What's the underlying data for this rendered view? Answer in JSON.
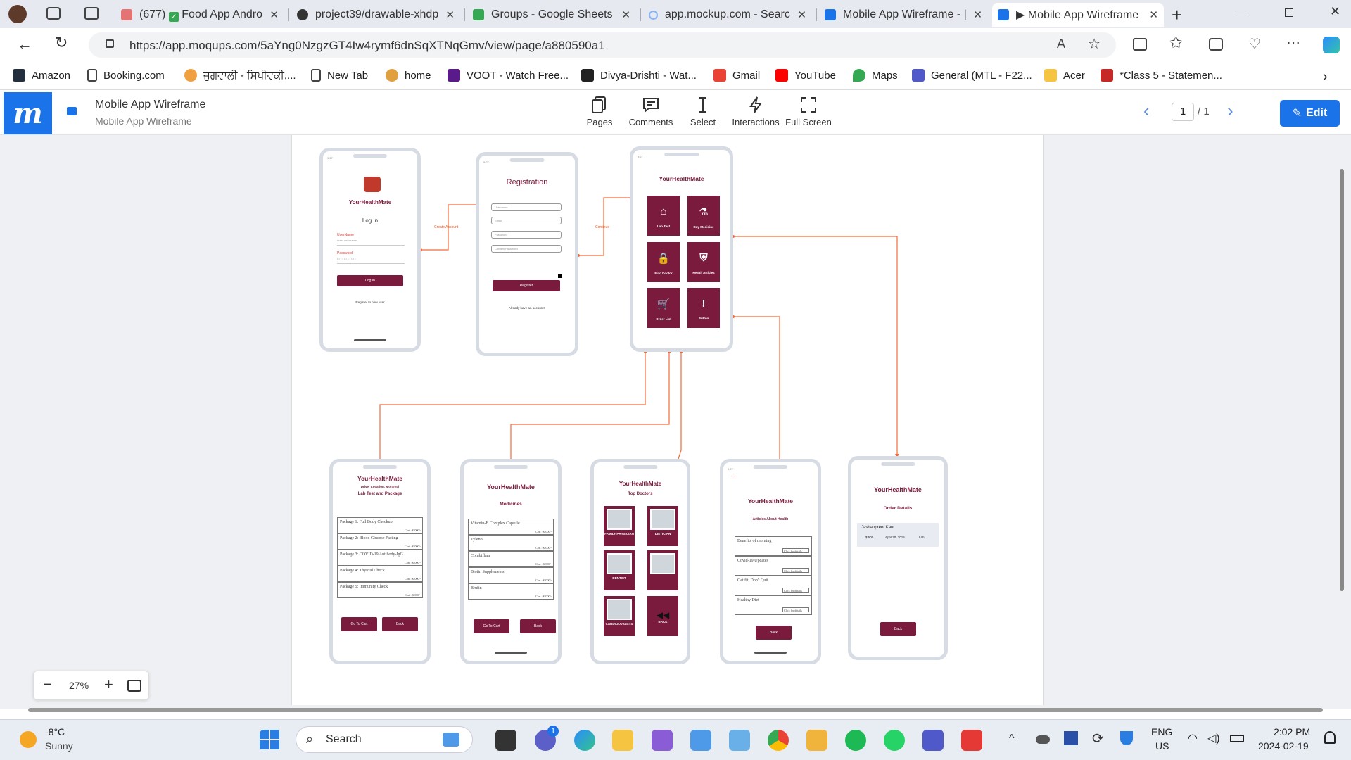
{
  "browser": {
    "tabs": [
      {
        "title": "(677)",
        "title2": "Food App Andro",
        "color": "#e57373"
      },
      {
        "title": "project39/drawable-xhdp",
        "color": "#333333"
      },
      {
        "title": "Groups - Google Sheets",
        "color": "#34a853"
      },
      {
        "title": "app.mockup.com - Searc",
        "color": "#8ab4f8"
      },
      {
        "title": "Mobile App Wireframe - |",
        "color": "#1a73e8"
      },
      {
        "title": "▶ Mobile App Wireframe",
        "color": "#1a73e8"
      }
    ],
    "url": "https://app.moqups.com/5aYng0NzgzGT4Iw4rymf6dnSqXTNqGmv/view/page/a880590a1",
    "bookmarks": [
      {
        "label": "Amazon",
        "color": "#232f3e"
      },
      {
        "label": "Booking.com",
        "color": "#ffffff"
      },
      {
        "label": "ਜੁਗਵਾਲੀ - ਸਿਖੀਵਕੀ,...",
        "color": "#f0a040"
      },
      {
        "label": "New Tab",
        "color": "#ffffff"
      },
      {
        "label": "home",
        "color": "#e0a040"
      },
      {
        "label": "VOOT - Watch Free...",
        "color": "#5a1a8a"
      },
      {
        "label": "Divya-Drishti - Wat...",
        "color": "#222222"
      },
      {
        "label": "Gmail",
        "color": "#ea4335"
      },
      {
        "label": "YouTube",
        "color": "#ff0000"
      },
      {
        "label": "Maps",
        "color": "#34a853"
      },
      {
        "label": "General (MTL - F22...",
        "color": "#5059c9"
      },
      {
        "label": "Acer",
        "color": "#f5c542"
      },
      {
        "label": "*Class 5 - Statemen...",
        "color": "#c62828"
      }
    ]
  },
  "moqups": {
    "title": "Mobile App Wireframe",
    "subtitle": "Mobile App Wireframe",
    "tools": [
      "Pages",
      "Comments",
      "Select",
      "Interactions",
      "Full Screen"
    ],
    "page_current": "1",
    "page_total": "/ 1",
    "edit_label": "Edit",
    "zoom": "27%"
  },
  "wireframe": {
    "app_name": "YourHealthMate",
    "login": {
      "heading": "Log In",
      "user_label": "UserName",
      "user_ph": "enter username",
      "pass_label": "Password",
      "pass_ph": "• • • • • • • • • • •",
      "button": "Log In",
      "link": "Register to new user"
    },
    "flow_labels": {
      "create": "Create Account",
      "continue": "Continue"
    },
    "registration": {
      "heading": "Registration",
      "fields": [
        "Username",
        "Email",
        "Password",
        "Confirm Password"
      ],
      "button": "Register",
      "link": "Already have an account?"
    },
    "home_tiles": [
      {
        "label": "Lab Test",
        "icon": "home-icon",
        "glyph": "⌂"
      },
      {
        "label": "Buy Medicine",
        "icon": "medicine-icon",
        "glyph": "⚗"
      },
      {
        "label": "Find Doctor",
        "icon": "lock-icon",
        "glyph": "🔒"
      },
      {
        "label": "Health Articles",
        "icon": "shield-icon",
        "glyph": "⛨"
      },
      {
        "label": "Order List",
        "icon": "cart-icon",
        "glyph": "🛒"
      },
      {
        "label": "Button",
        "icon": "exclamation-icon",
        "glyph": "!"
      }
    ],
    "lab": {
      "location": "Driver Location: Montreal",
      "heading": "Lab Test and Package",
      "rows": [
        "Package 1: Full Body Checkup",
        "Package 2: Blood Glucose Fasting",
        "Package 3: COVID-19 Antibody-IgG",
        "Package 4: Thyroid Check",
        "Package 5: Immunity Check"
      ],
      "cost": "Cost : $2000/-",
      "btn_cart": "Go To Cart",
      "btn_back": "Back"
    },
    "medicines": {
      "heading": "Medicines",
      "rows": [
        "Vitamin-B Complex Capsule",
        "Tylenol",
        "Combiflam",
        "Biotin Supplements",
        "Brufin"
      ],
      "cost": "Cost : $2000/-",
      "btn_cart": "Go To Cart",
      "btn_back": "Back"
    },
    "doctors": {
      "heading": "Top Doctors",
      "tiles": [
        "FAMILY PHYSICIAN",
        "DIETICIAN",
        "DENTIST",
        "",
        "CARDIOLO GISTS",
        "BACK"
      ]
    },
    "articles": {
      "heading": "Articles About Health",
      "rows": [
        "Benefits of morning",
        "Covid-19 Updates",
        "Get fit, Don't Quit",
        "Healthy Diet"
      ],
      "details": "Click for details",
      "button": "Back"
    },
    "orders": {
      "heading": "Order Details",
      "name": "Jashanpreet Kaur",
      "amount": "$ 500",
      "date": "April 20, 2015",
      "type": "Lab",
      "button": "Back"
    }
  },
  "taskbar": {
    "weather_temp": "-8°C",
    "weather_desc": "Sunny",
    "search": "Search",
    "lang": "ENG",
    "region": "US",
    "time": "2:02 PM",
    "date": "2024-02-19",
    "badge": "1"
  }
}
